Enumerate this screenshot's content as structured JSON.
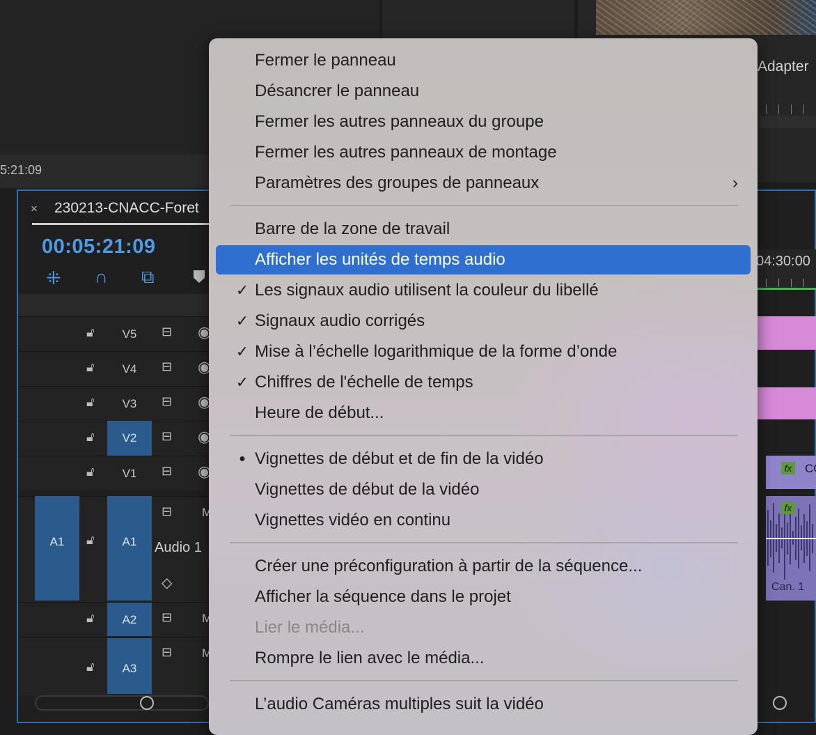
{
  "background": {
    "adapter_label": "Adapter",
    "source_timecode": "5:21:09",
    "sequence_tab": {
      "close_glyph": "×",
      "name": "230213-CNACC-Foret"
    },
    "playhead_timecode": "00:05:21:09",
    "ruler_time": "04:30:00",
    "tracks": [
      {
        "label": "V5"
      },
      {
        "label": "V4"
      },
      {
        "label": "V3"
      },
      {
        "label": "V2"
      },
      {
        "label": "V1"
      }
    ],
    "audio": {
      "a1_source": "A1",
      "a1_target": "A1",
      "a1_name": "Audio 1",
      "a2": "A2",
      "a3": "A3",
      "m_letter": "M"
    },
    "clip_labels": {
      "co": "CO",
      "fx": "fx",
      "channel": "Can. 1"
    }
  },
  "menu": {
    "items": [
      {
        "label": "Fermer le panneau",
        "mark": ""
      },
      {
        "label": "Désancrer le panneau",
        "mark": ""
      },
      {
        "label": "Fermer les autres panneaux du groupe",
        "mark": ""
      },
      {
        "label": "Fermer les autres panneaux de montage",
        "mark": ""
      },
      {
        "label": "Paramètres des groupes de panneaux",
        "mark": "",
        "submenu": "›"
      },
      {
        "label": "Barre de la zone de travail",
        "mark": ""
      },
      {
        "label": "Afficher les unités de temps audio",
        "mark": "",
        "highlighted": true
      },
      {
        "label": "Les signaux audio utilisent la couleur du libellé",
        "mark": "✓"
      },
      {
        "label": "Signaux audio corrigés",
        "mark": "✓"
      },
      {
        "label": "Mise à l’échelle logarithmique de la forme d’onde",
        "mark": "✓"
      },
      {
        "label": "Chiffres de l'échelle de temps",
        "mark": "✓"
      },
      {
        "label": "Heure de début...",
        "mark": ""
      },
      {
        "label": "Vignettes de début et de fin de la vidéo",
        "mark": "●"
      },
      {
        "label": "Vignettes de début de la vidéo",
        "mark": ""
      },
      {
        "label": "Vignettes vidéo en continu",
        "mark": ""
      },
      {
        "label": "Créer une préconfiguration à partir de la séquence...",
        "mark": ""
      },
      {
        "label": "Afficher la séquence dans le projet",
        "mark": ""
      },
      {
        "label": "Lier le média...",
        "mark": "",
        "disabled": true
      },
      {
        "label": "Rompre le lien avec le média...",
        "mark": ""
      },
      {
        "label": "L’audio Caméras multiples suit la vidéo",
        "mark": ""
      }
    ]
  },
  "colors": {
    "accent_blue": "#4d9be6",
    "menu_highlight": "#2f6fd0",
    "track_selected": "#2b5b8c",
    "clip_pink": "#d78ad8",
    "clip_purple": "#8f84cc",
    "ruler_green": "#3bbf4a"
  }
}
